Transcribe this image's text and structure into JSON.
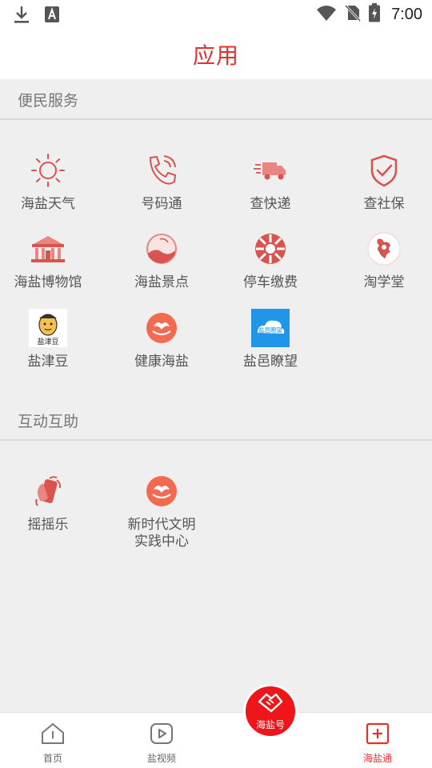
{
  "status_bar": {
    "time": "7:00",
    "icons": [
      "download-icon",
      "font-a-icon",
      "wifi-icon",
      "no-sim-icon",
      "battery-charging-icon"
    ]
  },
  "header": {
    "title": "应用"
  },
  "sections": [
    {
      "title": "便民服务",
      "items": [
        {
          "label": "海盐天气",
          "icon": "sun-icon"
        },
        {
          "label": "号码通",
          "icon": "phone-icon"
        },
        {
          "label": "查快递",
          "icon": "delivery-truck-icon"
        },
        {
          "label": "查社保",
          "icon": "shield-check-icon"
        },
        {
          "label": "海盐博物馆",
          "icon": "museum-icon"
        },
        {
          "label": "海盐景点",
          "icon": "scenic-spot-icon"
        },
        {
          "label": "停车缴费",
          "icon": "parking-wheel-icon"
        },
        {
          "label": "淘学堂",
          "icon": "taoxuetang-logo-icon"
        },
        {
          "label": "盐津豆",
          "icon": "yanjindou-logo-icon",
          "logo_text": "盐津豆"
        },
        {
          "label": "健康海盐",
          "icon": "health-haiyan-icon"
        },
        {
          "label": "盐邑瞭望",
          "icon": "yanyi-liaowang-icon",
          "logo_text": "盐邑瞭望"
        }
      ]
    },
    {
      "title": "互动互助",
      "items": [
        {
          "label": "摇摇乐",
          "icon": "shake-phone-icon"
        },
        {
          "label": "新时代文明实践中心",
          "icon": "civilization-center-icon"
        }
      ]
    }
  ],
  "bottom_nav": {
    "items": [
      {
        "label": "首页",
        "icon": "home-icon"
      },
      {
        "label": "盐视频",
        "icon": "video-play-icon"
      },
      {
        "label": "海盐号",
        "icon": "handshake-icon"
      },
      {
        "label": "海盐通",
        "icon": "plus-box-icon",
        "active": true
      }
    ]
  },
  "colors": {
    "accent": "#e8302a",
    "center_button": "#f0151b",
    "icon_red": "#d9534f"
  }
}
